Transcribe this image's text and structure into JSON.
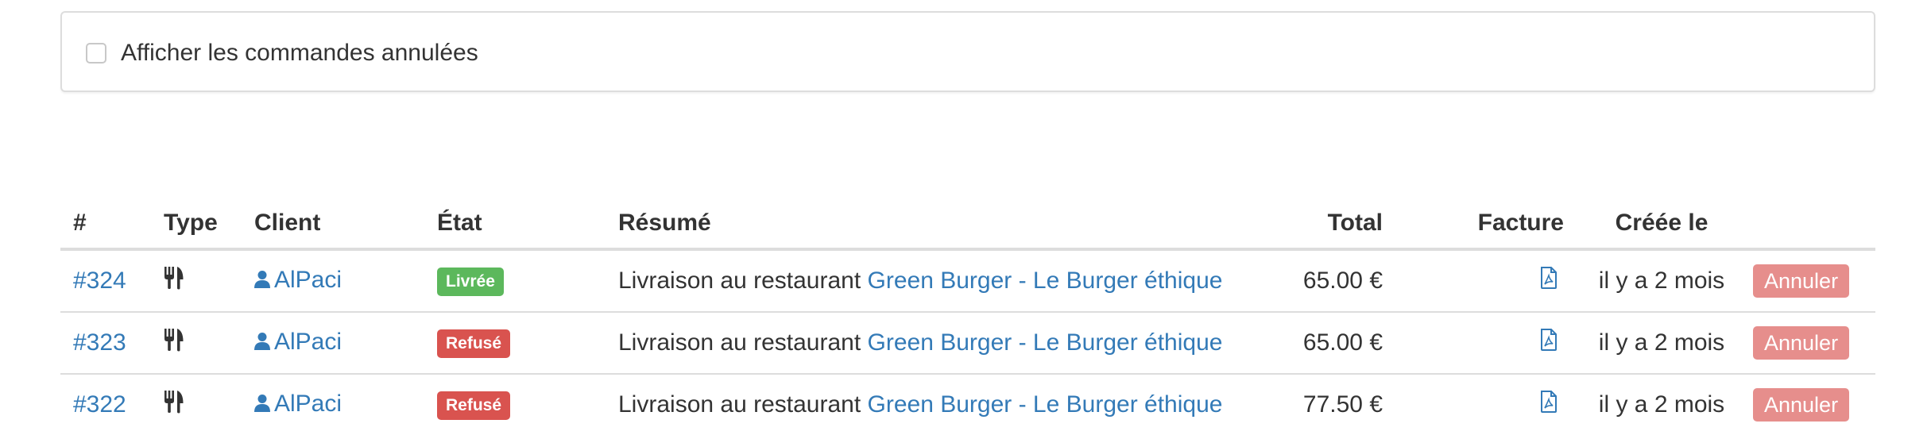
{
  "filter": {
    "show_cancelled_label": "Afficher les commandes annulées",
    "checked": false
  },
  "table": {
    "headers": {
      "id": "#",
      "type": "Type",
      "client": "Client",
      "state": "État",
      "summary": "Résumé",
      "total": "Total",
      "invoice": "Facture",
      "created": "Créée le"
    },
    "rows": [
      {
        "id": "#324",
        "type_icon": "cutlery-icon",
        "client": "AlPaci",
        "state": "Livrée",
        "state_color": "#5cb85c",
        "summary_prefix": "Livraison au restaurant",
        "restaurant": "Green Burger - Le Burger éthique",
        "total": "65.00 €",
        "invoice_icon": "pdf-file-icon",
        "created": "il y a 2 mois",
        "action": "Annuler"
      },
      {
        "id": "#323",
        "type_icon": "cutlery-icon",
        "client": "AlPaci",
        "state": "Refusé",
        "state_color": "#d9534f",
        "summary_prefix": "Livraison au restaurant",
        "restaurant": "Green Burger - Le Burger éthique",
        "total": "65.00 €",
        "invoice_icon": "pdf-file-icon",
        "created": "il y a 2 mois",
        "action": "Annuler"
      },
      {
        "id": "#322",
        "type_icon": "cutlery-icon",
        "client": "AlPaci",
        "state": "Refusé",
        "state_color": "#d9534f",
        "summary_prefix": "Livraison au restaurant",
        "restaurant": "Green Burger - Le Burger éthique",
        "total": "77.50 €",
        "invoice_icon": "pdf-file-icon",
        "created": "il y a 2 mois",
        "action": "Annuler"
      }
    ]
  },
  "colors": {
    "link": "#337ab7",
    "cancel_button": "#e68e8c",
    "border": "#dddddd"
  }
}
